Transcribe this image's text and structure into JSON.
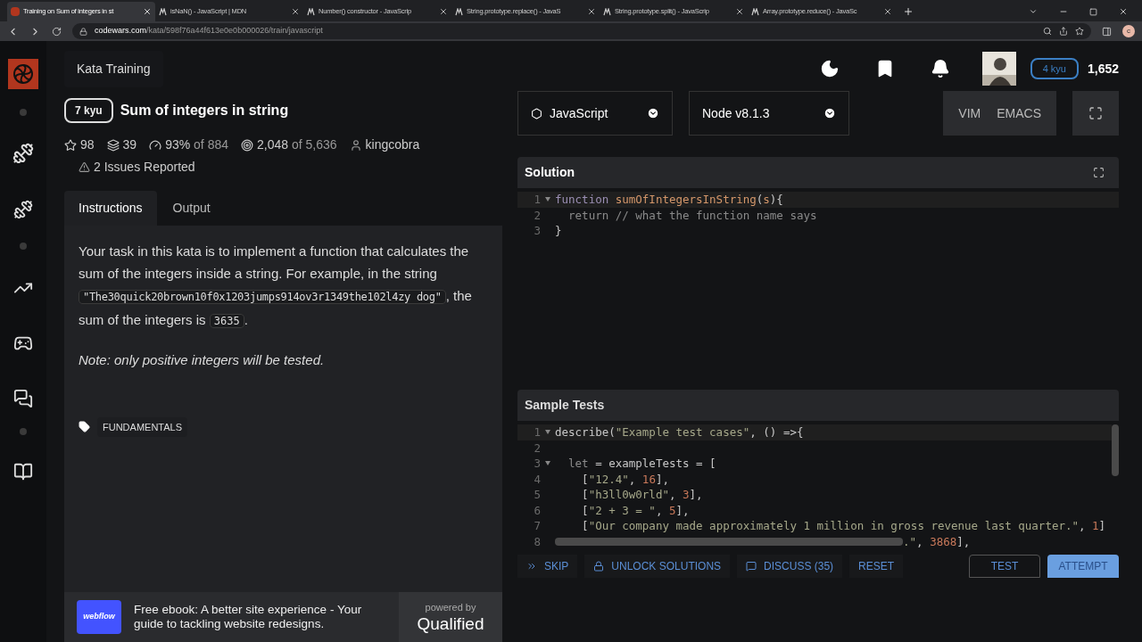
{
  "browser": {
    "tabs": [
      {
        "title": "Training on Sum of integers in st",
        "selected": true,
        "kind": "codewars"
      },
      {
        "title": "isNaN() - JavaScript | MDN",
        "selected": false,
        "kind": "mdn"
      },
      {
        "title": "Number() constructor - JavaScrip",
        "selected": false,
        "kind": "mdn"
      },
      {
        "title": "String.prototype.replace() - JavaS",
        "selected": false,
        "kind": "mdn"
      },
      {
        "title": "String.prototype.split() - JavaScrip",
        "selected": false,
        "kind": "mdn"
      },
      {
        "title": "Array.prototype.reduce() - JavaSc",
        "selected": false,
        "kind": "mdn"
      }
    ],
    "url_host": "codewars.com",
    "url_path": "/kata/598f76a44f613e0e0b000026/train/javascript",
    "profile_initial": "c"
  },
  "header": {
    "title": "Kata Training",
    "rank": "4 kyu",
    "honor": "1,652"
  },
  "kata": {
    "rank": "7 kyu",
    "name": "Sum of integers in string",
    "stars": "98",
    "collections": "39",
    "satisfaction": "93%",
    "satisfaction_of": "of 884",
    "completed": "2,048",
    "completed_of": "of 5,636",
    "author": "kingcobra",
    "issues": "2 Issues Reported"
  },
  "panel_tabs": [
    {
      "label": "Instructions",
      "selected": true
    },
    {
      "label": "Output",
      "selected": false
    }
  ],
  "instructions": {
    "intro": "Your task in this kata is to implement a function that calculates the sum of the integers inside a string. For example, in the string",
    "example": "\"The30quick20brown10f0x1203jumps914ov3r1349the102l4zy dog\"",
    "after_example": ",",
    "sum_prefix": "the sum of the integers is",
    "sum": "3635",
    "sum_suffix": ".",
    "note": "Note: only positive integers will be tested."
  },
  "tags": [
    "FUNDAMENTALS"
  ],
  "ad": {
    "logo": "webflow",
    "text": "Free ebook: A better site experience - Your guide to tackling website redesigns.",
    "powered_by": "powered by",
    "brand": "Qualified"
  },
  "language": "JavaScript",
  "version": "Node v8.1.3",
  "editor_modes": [
    "VIM",
    "EMACS"
  ],
  "solution": {
    "title": "Solution",
    "lines": [
      {
        "num": "1",
        "fold": true,
        "tokens": [
          {
            "t": "function ",
            "kind": "kw"
          },
          {
            "t": "sumOfIntegersInString",
            "kind": "fn"
          },
          {
            "t": "(",
            "kind": "p"
          },
          {
            "t": "s",
            "kind": "fn"
          },
          {
            "t": "){",
            "kind": "p"
          }
        ]
      },
      {
        "num": "2",
        "fold": false,
        "tokens": [
          {
            "t": "  return // what the function name says",
            "kind": "cm"
          }
        ]
      },
      {
        "num": "3",
        "fold": false,
        "tokens": [
          {
            "t": "}",
            "kind": "p"
          }
        ]
      }
    ]
  },
  "tests": {
    "title": "Sample Tests",
    "lines": [
      {
        "num": "1",
        "fold": true,
        "tokens": [
          {
            "t": "describe(",
            "kind": "p"
          },
          {
            "t": "\"Example test cases\"",
            "kind": "str"
          },
          {
            "t": ", () =>{",
            "kind": "p"
          }
        ]
      },
      {
        "num": "2",
        "fold": false
      },
      {
        "num": "3",
        "fold": true,
        "tokens": [
          {
            "t": "  let",
            "kind": "cm"
          },
          {
            "t": " = exampleTests = [",
            "kind": "p"
          }
        ]
      },
      {
        "num": "4",
        "fold": false,
        "tokens": [
          {
            "t": "    [",
            "kind": "p"
          },
          {
            "t": "\"12.4\"",
            "kind": "str"
          },
          {
            "t": ", ",
            "kind": "p"
          },
          {
            "t": "16",
            "kind": "num"
          },
          {
            "t": "],",
            "kind": "p"
          }
        ]
      },
      {
        "num": "5",
        "fold": false,
        "tokens": [
          {
            "t": "    [",
            "kind": "p"
          },
          {
            "t": "\"h3ll0w0rld\"",
            "kind": "str"
          },
          {
            "t": ", ",
            "kind": "p"
          },
          {
            "t": "3",
            "kind": "num"
          },
          {
            "t": "],",
            "kind": "p"
          }
        ]
      },
      {
        "num": "6",
        "fold": false,
        "tokens": [
          {
            "t": "    [",
            "kind": "p"
          },
          {
            "t": "\"2 + 3 = \"",
            "kind": "str"
          },
          {
            "t": ", ",
            "kind": "p"
          },
          {
            "t": "5",
            "kind": "num"
          },
          {
            "t": "],",
            "kind": "p"
          }
        ]
      },
      {
        "num": "7",
        "fold": false,
        "tokens": [
          {
            "t": "    [",
            "kind": "p"
          },
          {
            "t": "\"Our company made approximately 1 million in gross revenue last quarter.\"",
            "kind": "str"
          },
          {
            "t": ", ",
            "kind": "p"
          },
          {
            "t": "1",
            "kind": "num"
          },
          {
            "t": "]",
            "kind": "p"
          }
        ]
      },
      {
        "num": "8",
        "fold": false,
        "hidden_prefix": true,
        "tokens": [
          {
            "t": ".\"",
            "kind": "str"
          },
          {
            "t": ", ",
            "kind": "p"
          },
          {
            "t": "3868",
            "kind": "num"
          },
          {
            "t": "],",
            "kind": "p"
          }
        ]
      }
    ]
  },
  "actions": [
    {
      "label": "SKIP",
      "kind": "skip"
    },
    {
      "label": "UNLOCK SOLUTIONS",
      "kind": "lock"
    },
    {
      "label": "DISCUSS (35)",
      "kind": "discuss"
    },
    {
      "label": "RESET",
      "kind": "plain"
    }
  ],
  "run_buttons": [
    {
      "label": "TEST",
      "kind": "outline"
    },
    {
      "label": "ATTEMPT",
      "kind": "primary"
    }
  ]
}
